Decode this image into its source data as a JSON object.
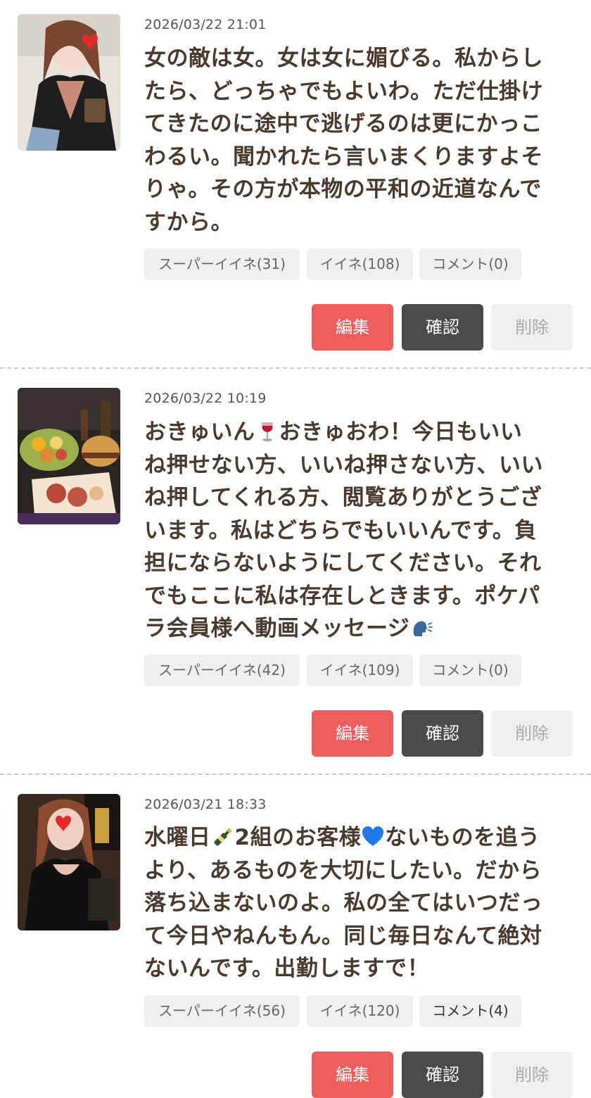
{
  "posts": [
    {
      "date": "2026/03/22 21:01",
      "lines": [
        "女の敵は女。女は女に媚びる。私からし",
        "たら、どっちゃでもよいわ。ただ仕掛け",
        "てきたのに途中で逃げるのは更にかっこ",
        "わるい。聞かれたら言いまくりますよそ",
        "りゃ。その方が本物の平和の近道なんで",
        "すから。"
      ],
      "super_like": "スーパーイイネ(31)",
      "like": "イイネ(108)",
      "comment": "コメント(0)"
    },
    {
      "date": "2026/03/22 10:19",
      "lines_parts": {
        "l1a": "おきゅいん",
        "l1b": "おきゅおわ！今日もいい",
        "l2": "ね押せない方、いいね押さない方、いい",
        "l3": "ね押してくれる方、閲覧ありがとうござ",
        "l4": "います。私はどちらでもいいんです。負",
        "l5": "担にならないようにしてください。それ",
        "l6": "でもここに私は存在しときます。ポケパ",
        "l7": "ラ会員様へ動画メッセージ"
      },
      "emojis": [
        "wine-glass-icon",
        "speaking-head-icon"
      ],
      "super_like": "スーパーイイネ(42)",
      "like": "イイネ(109)",
      "comment": "コメント(0)"
    },
    {
      "date": "2026/03/21 18:33",
      "lines_parts": {
        "l1a": "水曜日",
        "l1b": "2組のお客様",
        "l1c": "ないものを追う",
        "l2": "より、あるものを大切にしたい。だから",
        "l3": "落ち込まないのよ。私の全てはいつだっ",
        "l4": "て今日やねんもん。同じ毎日なんて絶対",
        "l5": "ないんです。出勤しますで！"
      },
      "emojis": [
        "champagne-bottle-icon",
        "blue-heart-icon"
      ],
      "super_like": "スーパーイイネ(56)",
      "like": "イイネ(120)",
      "comment": "コメント(4)"
    }
  ],
  "buttons": {
    "edit": "編集",
    "confirm": "確認",
    "delete": "削除"
  },
  "colors": {
    "edit_bg": "#ee5e5d",
    "confirm_bg": "#4b4b4b",
    "delete_bg": "#efefef",
    "chip_bg": "#efefef",
    "text": "#4a3a2e"
  }
}
